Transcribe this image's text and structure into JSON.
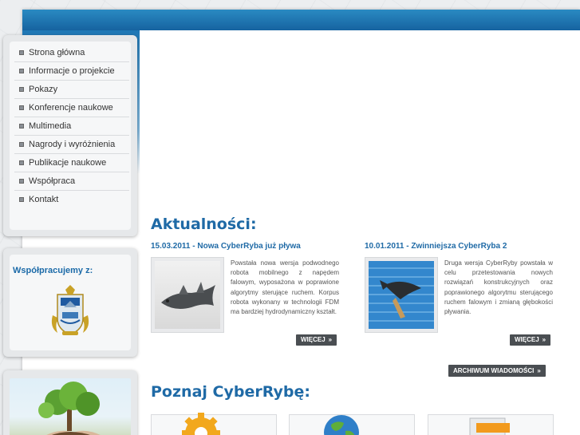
{
  "menu": {
    "items": [
      "Strona główna",
      "Informacje o projekcie",
      "Pokazy",
      "Konferencje naukowe",
      "Multimedia",
      "Nagrody i wyróżnienia",
      "Publikacje naukowe",
      "Współpraca",
      "Kontakt"
    ]
  },
  "partners": {
    "title": "Współpracujemy z:"
  },
  "news": {
    "heading": "Aktualności:",
    "items": [
      {
        "date": "15.03.2011",
        "title": "Nowa CyberRyba już pływa",
        "text": "Powstała nowa wersja podwodnego robota mobilnego z napędem falowym, wyposażona w poprawione algorytmy sterujące ruchem. Korpus robota wykonany w technologii FDM ma bardziej hydrodynamiczny kształt.",
        "more": "WIĘCEJ"
      },
      {
        "date": "10.01.2011",
        "title": "Zwinniejsza CyberRyba 2",
        "text": "Druga wersja CyberRyby powstała w celu przetestowania nowych rozwiązań konstrukcyjnych oraz poprawionego algorytmu sterującego ruchem falowym i zmianą głębokości pływania.",
        "more": "WIĘCEJ"
      }
    ],
    "archive": "ARCHIWUM WIADOMOŚCI"
  },
  "discover": {
    "heading": "Poznaj CyberRybę:"
  },
  "colors": {
    "brand_blue": "#1f6aa6",
    "button_dark": "#4a4e52"
  },
  "icons": [
    "gear-icon",
    "globe-icon",
    "document-icon",
    "double-chevron-right-icon"
  ]
}
